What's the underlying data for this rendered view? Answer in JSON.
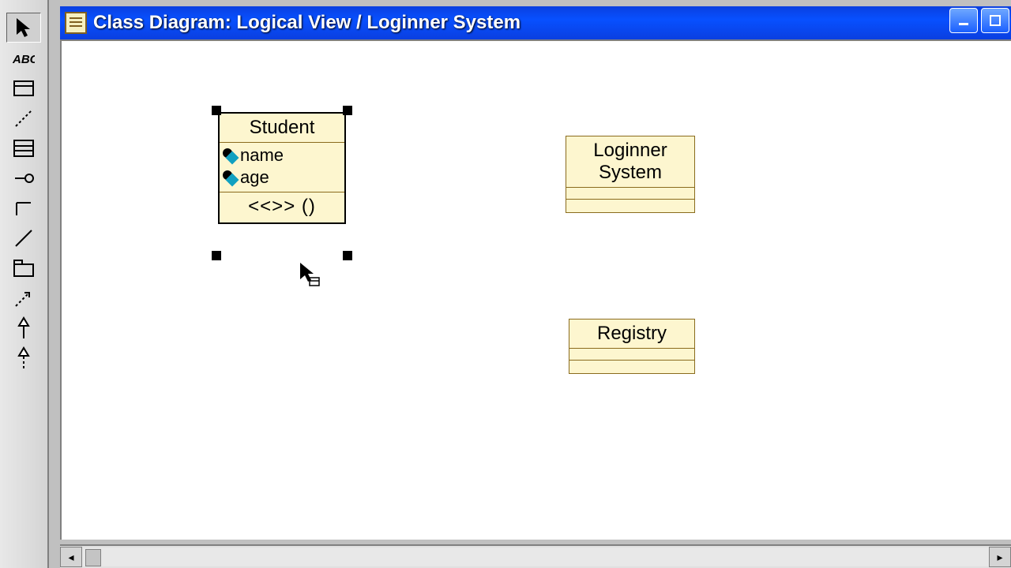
{
  "window": {
    "title": "Class Diagram: Logical View / Loginner System"
  },
  "classes": {
    "student": {
      "name": "Student",
      "attrs": [
        "name",
        "age"
      ],
      "op_editing": "<<>> ()"
    },
    "loginner": {
      "name": "Loginner System"
    },
    "registry": {
      "name": "Registry"
    }
  }
}
